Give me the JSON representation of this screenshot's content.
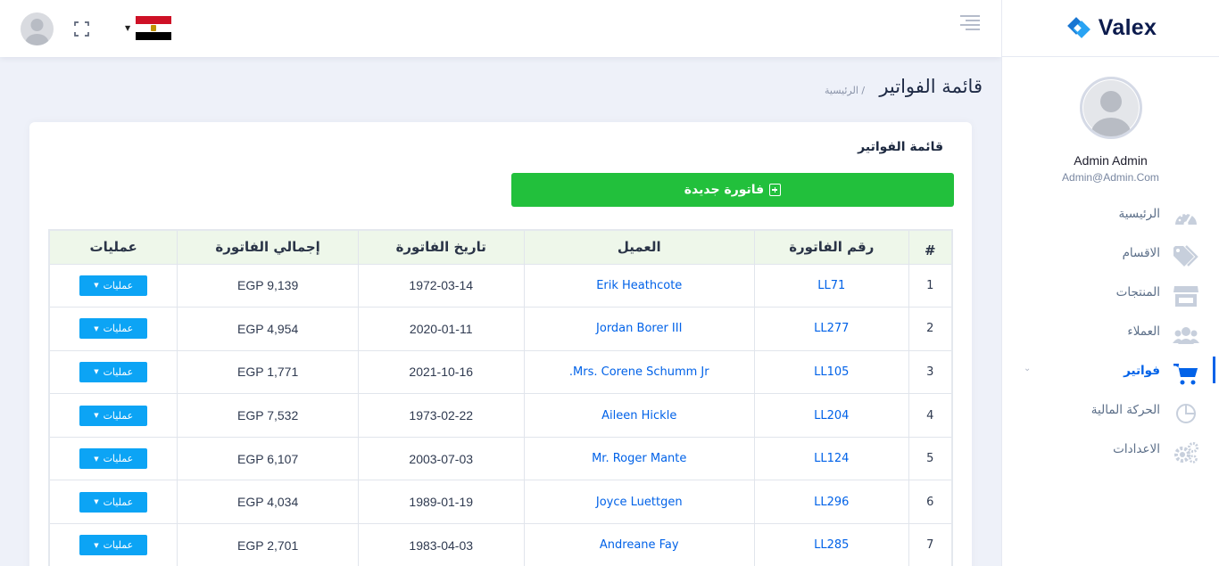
{
  "brand": {
    "name": "Valex",
    "accent": "#0162e8"
  },
  "user": {
    "name": "Admin Admin",
    "email": "Admin@Admin.Com"
  },
  "sidebar": {
    "items": [
      {
        "label": "الرئيسية",
        "icon": "speedometer-icon",
        "active": false
      },
      {
        "label": "الاقسام",
        "icon": "tags-icon",
        "active": false
      },
      {
        "label": "المنتجات",
        "icon": "store-icon",
        "active": false
      },
      {
        "label": "العملاء",
        "icon": "users-icon",
        "active": false
      },
      {
        "label": "فواتير",
        "icon": "cart-icon",
        "active": true
      },
      {
        "label": "الحركة المالية",
        "icon": "pie-chart-icon",
        "active": false
      },
      {
        "label": "الاعدادات",
        "icon": "gears-icon",
        "active": false
      }
    ]
  },
  "header": {
    "language_flag": "egypt-flag-icon"
  },
  "page": {
    "title": "قائمة الفواتير",
    "breadcrumb": "/ الرئيسية"
  },
  "card": {
    "title": "قائمة الفواتير",
    "new_invoice_label": "فاتورة جديدة"
  },
  "table": {
    "headers": {
      "num": "#",
      "invoice": "رقم الفاتورة",
      "customer": "العميل",
      "date": "تاريخ الفاتورة",
      "total": "إجمالي الفاتورة",
      "ops": "عمليات"
    },
    "ops_label": "عمليات",
    "rows": [
      {
        "num": "1",
        "invoice": "LL71",
        "customer": "Erik Heathcote",
        "date": "1972-03-14",
        "total": "EGP 9,139"
      },
      {
        "num": "2",
        "invoice": "LL277",
        "customer": "Jordan Borer III",
        "date": "2020-01-11",
        "total": "EGP 4,954"
      },
      {
        "num": "3",
        "invoice": "LL105",
        "customer": "Mrs. Corene Schumm Jr.",
        "date": "2021-10-16",
        "total": "EGP 1,771"
      },
      {
        "num": "4",
        "invoice": "LL204",
        "customer": "Aileen Hickle",
        "date": "1973-02-22",
        "total": "EGP 7,532"
      },
      {
        "num": "5",
        "invoice": "LL124",
        "customer": "Mr. Roger Mante",
        "date": "2003-07-03",
        "total": "EGP 6,107"
      },
      {
        "num": "6",
        "invoice": "LL296",
        "customer": "Joyce Luettgen",
        "date": "1989-01-19",
        "total": "EGP 4,034"
      },
      {
        "num": "7",
        "invoice": "LL285",
        "customer": "Andreane Fay",
        "date": "1983-04-03",
        "total": "EGP 2,701"
      }
    ]
  }
}
